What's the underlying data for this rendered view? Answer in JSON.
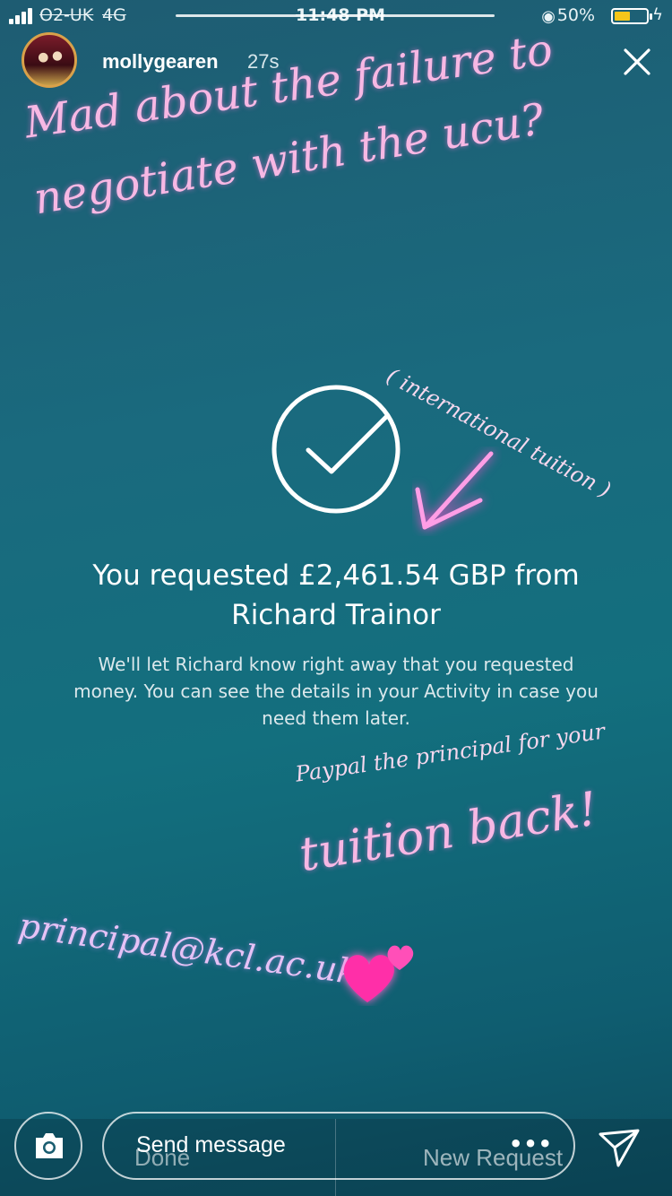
{
  "status_bar": {
    "carrier": "O2-UK",
    "network": "4G",
    "time": "11:48 PM",
    "battery_percent": "50%",
    "battery_level": 0.5
  },
  "story": {
    "username": "mollygearen",
    "timestamp": "27s",
    "progress": 1.0
  },
  "stickers": {
    "headline_line1": "Mad about the failure to",
    "headline_line2": "negotiate with the ucu?",
    "international": "( international tuition )",
    "paypal_note": "Paypal the principal for your",
    "tuition_back": "tuition back!",
    "email": "principal@kcl.ac.uk"
  },
  "content": {
    "title_line1": "You requested £2,461.54 GBP from",
    "title_line2": "Richard Trainor",
    "body_line1": "We'll let Richard know right away that you requested",
    "body_line2": "money. You can see the details in your Activity in case you",
    "body_line3": "need them later."
  },
  "bottom": {
    "send_message": "Send message",
    "done": "Done",
    "new_request": "New Request",
    "more": "•••"
  },
  "colors": {
    "accent_pink": "#f7b8e4",
    "battery": "#f4c61a",
    "heart": "#ff2fa8"
  }
}
